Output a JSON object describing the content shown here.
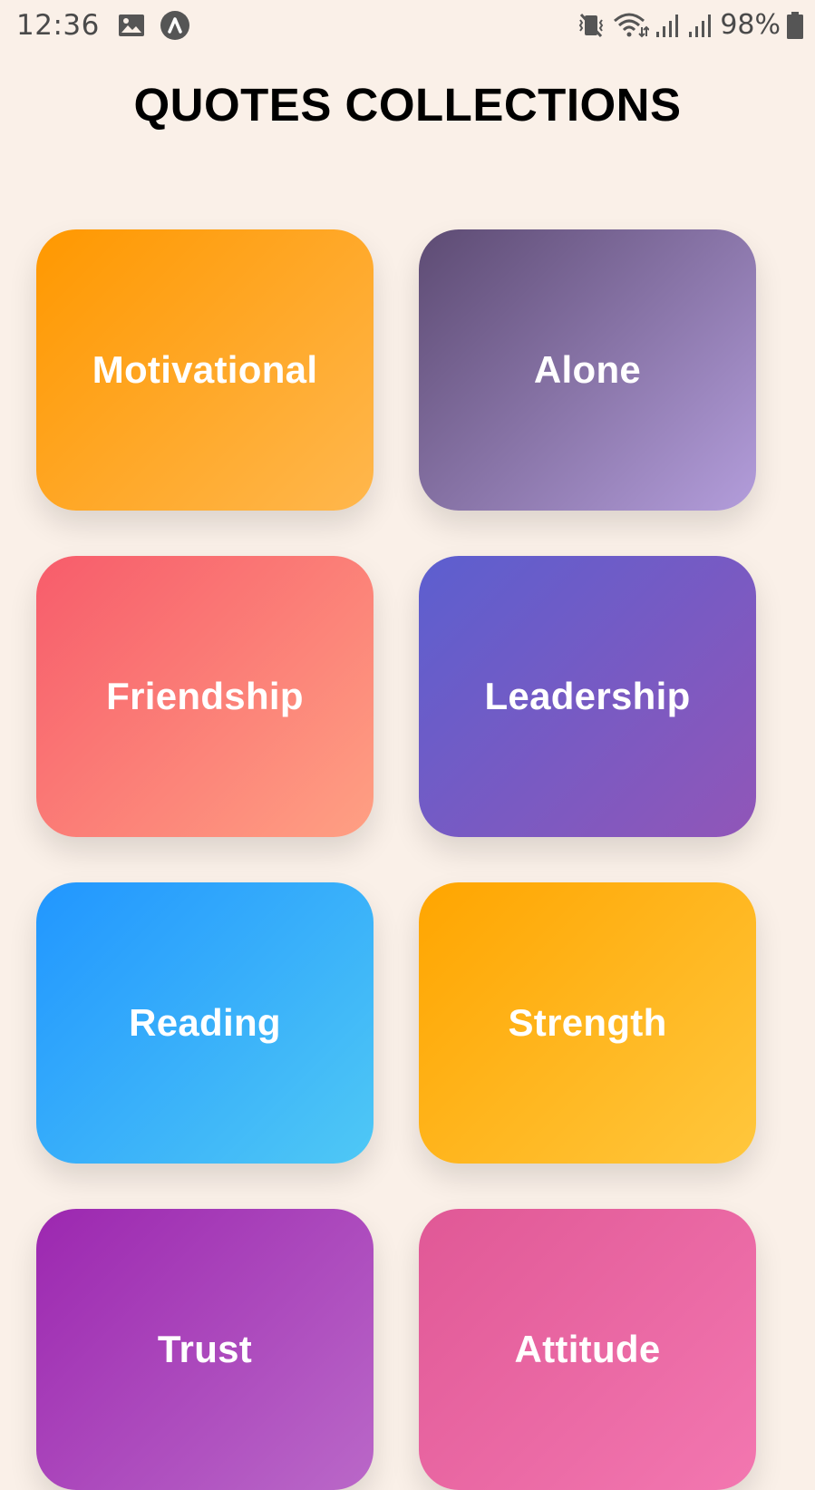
{
  "status_bar": {
    "time": "12:36",
    "battery": "98%",
    "icons": [
      "gallery-icon",
      "app-a-icon",
      "vibrate-mute-icon",
      "wifi-icon",
      "signal-icon",
      "signal-2-icon",
      "battery-icon"
    ]
  },
  "header": {
    "title": "QUOTES COLLECTIONS"
  },
  "categories": [
    {
      "label": "Motivational",
      "color_from": "#ff9800",
      "color_to": "#ffb74d"
    },
    {
      "label": "Alone",
      "color_from": "#5d4b73",
      "color_to": "#b39ddb"
    },
    {
      "label": "Friendship",
      "color_from": "#f75c6b",
      "color_to": "#ffa083"
    },
    {
      "label": "Leadership",
      "color_from": "#5c5fcf",
      "color_to": "#9156b8"
    },
    {
      "label": "Reading",
      "color_from": "#2196ff",
      "color_to": "#4fc8f5"
    },
    {
      "label": "Strength",
      "color_from": "#ffa500",
      "color_to": "#ffc73d"
    },
    {
      "label": "Trust",
      "color_from": "#9c27b0",
      "color_to": "#ba68c8"
    },
    {
      "label": "Attitude",
      "color_from": "#e05896",
      "color_to": "#f377b0"
    }
  ]
}
